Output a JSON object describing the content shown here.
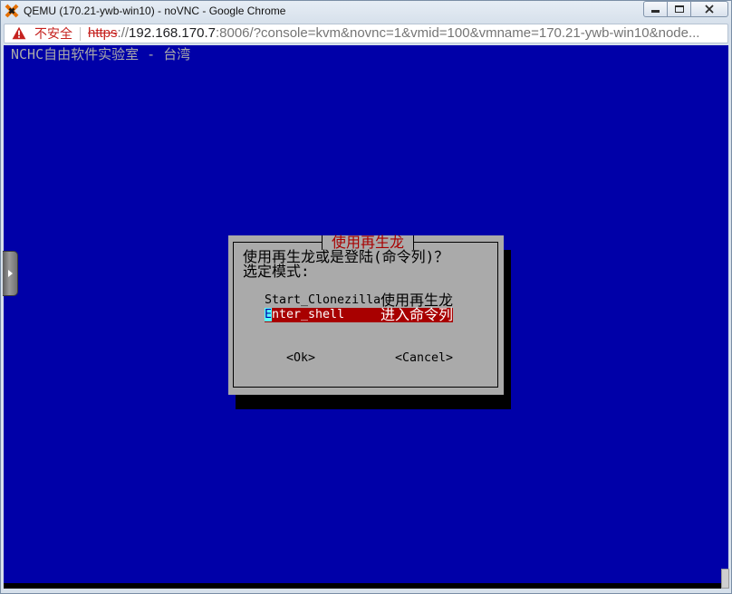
{
  "window": {
    "title": "QEMU (170.21-ywb-win10) - noVNC - Google Chrome"
  },
  "address_bar": {
    "security_label": "不安全",
    "url": {
      "scheme": "https",
      "separator": "://",
      "host": "192.168.170.7",
      "rest": ":8006/?console=kvm&novnc=1&vmid=100&vmname=170.21-ywb-win10&node..."
    }
  },
  "console": {
    "banner": "NCHC自由软件实验室 - 台湾"
  },
  "dialog": {
    "title": "使用再生龙",
    "prompt": "使用再生龙或是登陆(命令列)？",
    "mode_label": "选定模式:",
    "options": [
      {
        "key": "Start_Clonezilla",
        "description": "使用再生龙",
        "selected": false
      },
      {
        "key": "Enter_shell",
        "description": "进入命令列",
        "selected": true
      }
    ],
    "buttons": {
      "ok": "<Ok>",
      "cancel": "<Cancel>"
    }
  },
  "icons": {
    "app_logo": "proxmox-logo-icon",
    "security": "warning-icon",
    "minimize": "minimize-icon",
    "maximize": "maximize-icon",
    "close": "close-icon",
    "vnc_control_bar_toggle": "chevron-right-icon"
  },
  "colors": {
    "console_bg": "#0000a8",
    "dialog_bg": "#aaaaaa",
    "dialog_text": "#000000",
    "dialog_title": "#a80000",
    "highlight_bg": "#a80000",
    "highlight_fg": "#ffffff",
    "cursor_bg": "#55ffff",
    "cursor_fg": "#0000a8",
    "banner_text": "#aaaaaa",
    "shadow": "#000000",
    "insecure": "#c5221f"
  }
}
